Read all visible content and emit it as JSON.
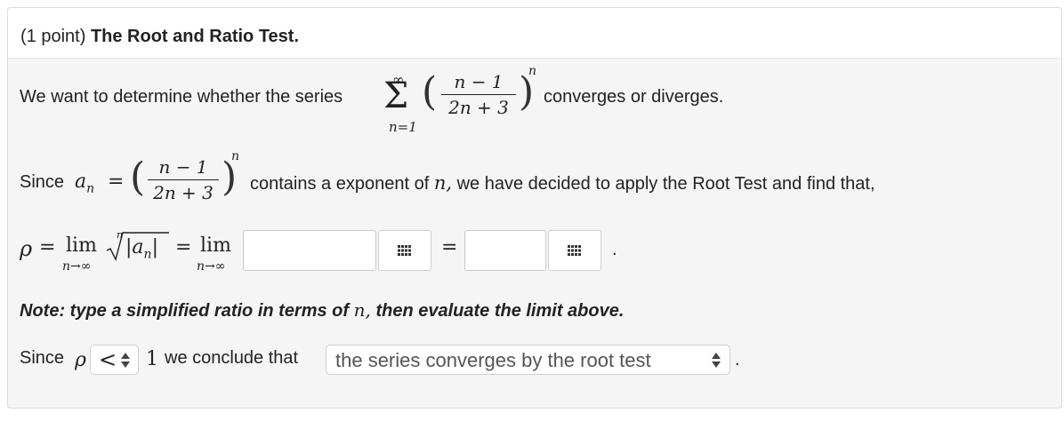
{
  "problem": {
    "header_points": "(1 point)",
    "header_title": "The Root and Ratio Test.",
    "line1_prefix": "We want to determine whether the series",
    "line1_suffix": "converges or diverges.",
    "line2_since": "Since",
    "line2_suffix": "contains a exponent of",
    "line2_var": "n,",
    "line2_rest": "we have decided to apply the Root Test and find that,",
    "note_prefix": "Note: type a simplified ratio in terms of",
    "note_var": "n,",
    "note_suffix": "then evaluate the limit above.",
    "since_prefix": "Since",
    "conclude_text": "we conclude that",
    "one_value": "1",
    "period": "."
  },
  "math": {
    "sum_symbol": "Σ",
    "sum_top": "∞",
    "sum_bottom": "n=1",
    "numerator": "n − 1",
    "denominator": "2n + 3",
    "exponent": "n",
    "a_n": "a",
    "a_sub": "n",
    "equals": "=",
    "rho": "ρ",
    "lim": "lim",
    "lim_sub": "n→∞",
    "root_index": "n",
    "abs_an": "|a",
    "abs_close": "|",
    "paren_open": "(",
    "paren_close": ")"
  },
  "inputs": {
    "ratio_value": "",
    "limit_value": ""
  },
  "selects": {
    "comparison_value": "<",
    "conclusion_value": "the series converges by the root test"
  }
}
